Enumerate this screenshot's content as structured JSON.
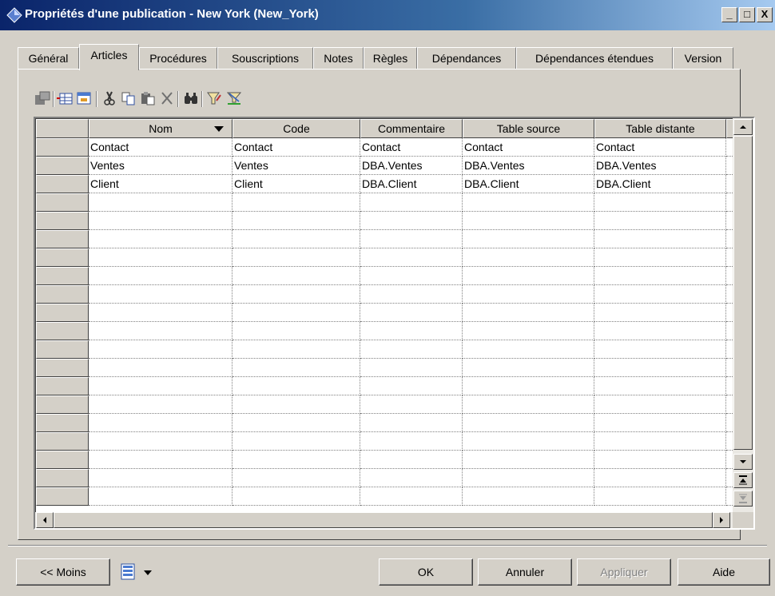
{
  "window": {
    "title": "Propriétés d'une publication - New York (New_York)",
    "controls": {
      "minimize": "_",
      "maximize": "□",
      "close": "X"
    }
  },
  "tabs": [
    {
      "label": "Général"
    },
    {
      "label": "Articles",
      "active": true
    },
    {
      "label": "Procédures"
    },
    {
      "label": "Souscriptions"
    },
    {
      "label": "Notes"
    },
    {
      "label": "Règles"
    },
    {
      "label": "Dépendances"
    },
    {
      "label": "Dépendances étendues"
    },
    {
      "label": "Version"
    }
  ],
  "toolbar": {
    "icons": [
      "properties-icon",
      "add-row-icon",
      "insert-row-icon",
      "cut-icon",
      "copy-icon",
      "paste-icon",
      "delete-icon",
      "find-icon",
      "filter-icon",
      "clear-filter-icon"
    ]
  },
  "grid": {
    "columns": [
      "Nom",
      "Code",
      "Commentaire",
      "Table source",
      "Table distante"
    ],
    "sort_column": "Nom",
    "rows": [
      [
        "Contact",
        "Contact",
        "Contact",
        "Contact",
        "Contact"
      ],
      [
        "Ventes",
        "Ventes",
        "DBA.Ventes",
        "DBA.Ventes",
        "DBA.Ventes"
      ],
      [
        "Client",
        "Client",
        "DBA.Client",
        "DBA.Client",
        "DBA.Client"
      ]
    ],
    "empty_rows": 17
  },
  "footer": {
    "less_label": "<< Moins",
    "ok_label": "OK",
    "cancel_label": "Annuler",
    "apply_label": "Appliquer",
    "help_label": "Aide"
  },
  "colors": {
    "titlebar_start": "#0a246a",
    "titlebar_end": "#a6caf0",
    "face": "#d4d0c8"
  }
}
